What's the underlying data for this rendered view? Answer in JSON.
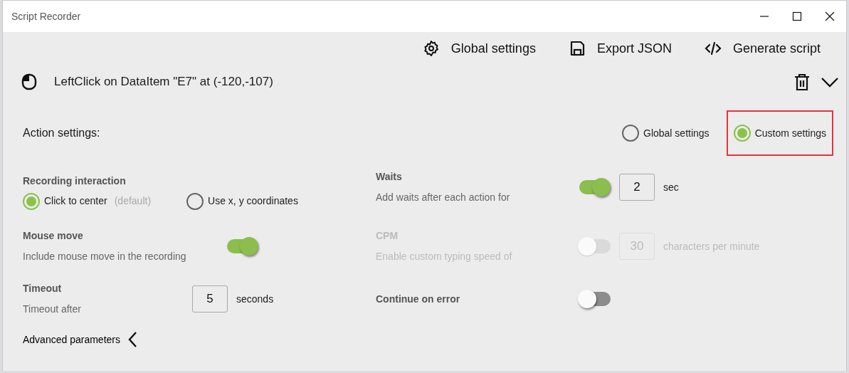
{
  "window": {
    "title": "Script Recorder"
  },
  "toolbar": [
    {
      "kind": "settings",
      "label": "Global settings"
    },
    {
      "kind": "export",
      "label": "Export JSON"
    },
    {
      "kind": "code",
      "label": "Generate script"
    }
  ],
  "action": {
    "text": "LeftClick on DataItem \"E7\" at (-120,-107)",
    "expanded": true
  },
  "action_settings": {
    "label": "Action settings:",
    "options": [
      {
        "label": "Global settings",
        "selected": false,
        "highlighted": false
      },
      {
        "label": "Custom settings",
        "selected": true,
        "highlighted": true
      }
    ]
  },
  "recording_interaction": {
    "title": "Recording interaction",
    "options": [
      {
        "label": "Click to center",
        "note": "(default)",
        "selected": true
      },
      {
        "label": "Use x, y coordinates",
        "selected": false
      }
    ]
  },
  "mouse_move": {
    "title": "Mouse move",
    "description": "Include mouse move in the recording",
    "on": true
  },
  "timeout": {
    "title": "Timeout",
    "description": "Timeout after",
    "value": "5",
    "unit": "seconds"
  },
  "waits": {
    "title": "Waits",
    "description": "Add waits after each action for",
    "on": true,
    "value": "2",
    "unit": "sec"
  },
  "cpm": {
    "title": "CPM",
    "description": "Enable custom typing speed of",
    "on": false,
    "disabled": true,
    "value": "30",
    "unit": "characters per minute"
  },
  "continue_on_error": {
    "title": "Continue on error",
    "on": false
  },
  "advanced": {
    "label": "Advanced parameters",
    "expanded": false
  }
}
